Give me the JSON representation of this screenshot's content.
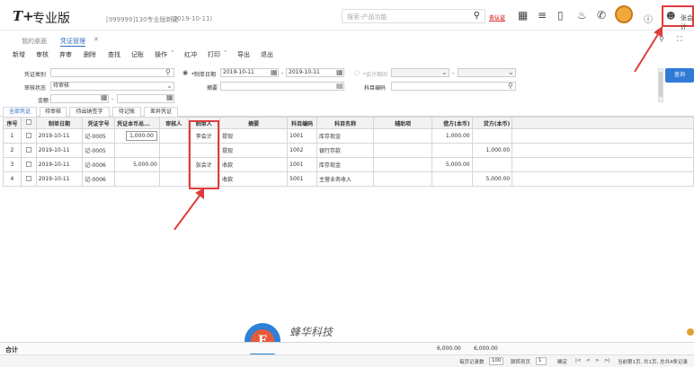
{
  "app": {
    "logo": "T+",
    "product": "专业版",
    "account": "[999999]130专业版新建",
    "date": "(2019-10-11)"
  },
  "search": {
    "placeholder": "搜索-产品功能"
  },
  "badge": "去认证",
  "user": {
    "name": "张会计"
  },
  "tabs": [
    {
      "label": "我的桌面"
    },
    {
      "label": "凭证管理"
    }
  ],
  "toolbar": [
    "新增",
    "审核",
    "弃审",
    "删除",
    "查找",
    "记账",
    "操作",
    "红冲",
    "打印",
    "导出",
    "退出"
  ],
  "filter": {
    "voucher_type_label": "凭证类别",
    "audit_status_label": "审核状态",
    "audit_status_value": "待审核",
    "amount_label": "金额",
    "date_radio_label": "*制单日期",
    "date_from": "2019-10-11",
    "date_to": "2019-10-11",
    "period_radio_label": "*会计期间",
    "summary_label": "摘要",
    "account_code_label": "科目编码",
    "search_button": "查询"
  },
  "subtabs": [
    "全部凭证",
    "待审核",
    "待出纳签字",
    "待记账",
    "差异凭证"
  ],
  "table": {
    "headers": {
      "seq": "序号",
      "date": "制单日期",
      "voucher_no": "凭证字号",
      "amount": "凭证本币总...",
      "auditor": "审核人",
      "maker": "制单人",
      "summary": "摘要",
      "account_code": "科目编码",
      "account_name": "科目名称",
      "aux": "辅助项",
      "debit": "借方(本币)",
      "credit": "贷方(本币)"
    },
    "rows": [
      {
        "seq": "1",
        "date": "2019-10-11",
        "voucher_no": "记-0005",
        "amount": "1,000.00",
        "auditor": "",
        "maker": "李会计",
        "summary": "提现",
        "account_code": "1001",
        "account_name": "库存现金",
        "aux": "",
        "debit": "1,000.00",
        "credit": ""
      },
      {
        "seq": "2",
        "date": "2019-10-11",
        "voucher_no": "记-0005",
        "amount": "",
        "auditor": "",
        "maker": "",
        "summary": "提现",
        "account_code": "1002",
        "account_name": "银行存款",
        "aux": "",
        "debit": "",
        "credit": "1,000.00"
      },
      {
        "seq": "3",
        "date": "2019-10-11",
        "voucher_no": "记-0006",
        "amount": "5,000.00",
        "auditor": "",
        "maker": "张会计",
        "summary": "收款",
        "account_code": "1001",
        "account_name": "库存现金",
        "aux": "",
        "debit": "5,000.00",
        "credit": ""
      },
      {
        "seq": "4",
        "date": "2019-10-11",
        "voucher_no": "记-0006",
        "amount": "",
        "auditor": "",
        "maker": "",
        "summary": "收款",
        "account_code": "5001",
        "account_name": "主营业务收入",
        "aux": "",
        "debit": "",
        "credit": "5,000.00"
      }
    ]
  },
  "totals": {
    "label": "合计",
    "debit": "6,000.00",
    "credit": "6,000.00"
  },
  "footer": {
    "page_size_label": "每页记录数",
    "page_size": "100",
    "jump_label": "跳转到页",
    "jump_value": "1",
    "confirm": "确定",
    "status": "当前第1页, 共1页, 总共4条记录"
  },
  "watermark": {
    "logo_letter": "F",
    "name": "蜂华科技",
    "url": "www.yonyou.org.cn"
  },
  "colors": {
    "accent": "#2f7bd6",
    "highlight": "#e03c3c"
  }
}
